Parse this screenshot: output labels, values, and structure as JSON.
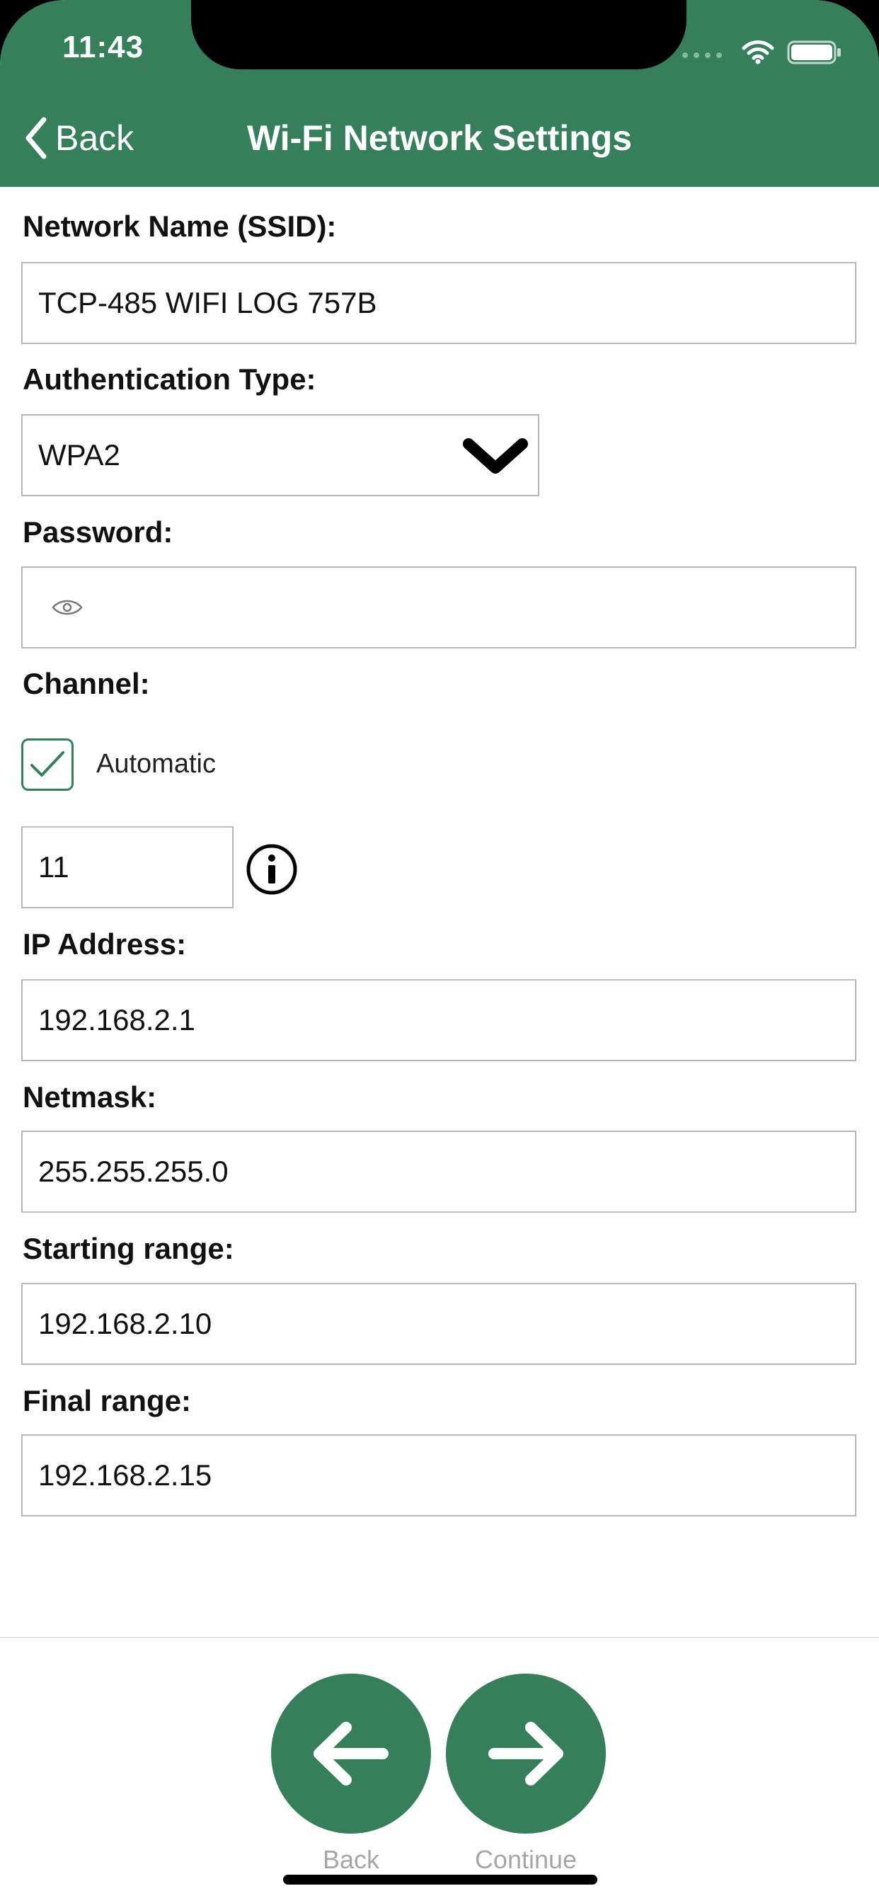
{
  "status_bar": {
    "time": "11:43"
  },
  "nav": {
    "back_label": "Back",
    "title": "Wi-Fi Network Settings"
  },
  "form": {
    "ssid_label": "Network Name (SSID):",
    "ssid_value": "TCP-485 WIFI LOG 757B",
    "auth_label": "Authentication Type:",
    "auth_value": "WPA2",
    "password_label": "Password:",
    "password_value": "",
    "channel_label": "Channel:",
    "automatic_label": "Automatic",
    "automatic_checked": true,
    "channel_value": "11",
    "ip_label": "IP Address:",
    "ip_value": "192.168.2.1",
    "netmask_label": "Netmask:",
    "netmask_value": "255.255.255.0",
    "start_label": "Starting range:",
    "start_value": "192.168.2.10",
    "final_label": "Final range:",
    "final_value": "192.168.2.15"
  },
  "bottom": {
    "back_label": "Back",
    "continue_label": "Continue"
  },
  "colors": {
    "accent": "#357f5b",
    "border": "#b8b8b8",
    "caption": "#a6a6a6"
  },
  "icons": [
    "chevron-left-icon",
    "chevron-down-icon",
    "eye-icon",
    "checkmark-icon",
    "info-icon",
    "arrow-left-icon",
    "arrow-right-icon",
    "wifi-icon",
    "battery-icon",
    "signal-icon"
  ]
}
